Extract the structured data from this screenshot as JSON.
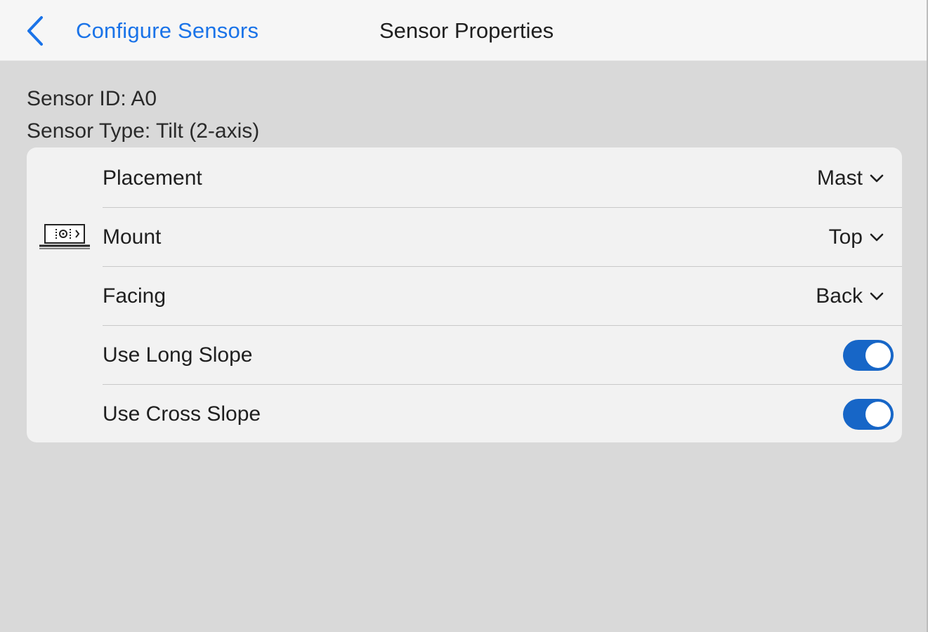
{
  "header": {
    "back_label": "Configure Sensors",
    "title": "Sensor Properties"
  },
  "sensor": {
    "id_text": "Sensor ID: A0",
    "type_text": "Sensor Type: Tilt (2-axis)",
    "icon": "tilt-sensor-icon"
  },
  "properties": {
    "placement": {
      "label": "Placement",
      "value": "Mast"
    },
    "mount": {
      "label": "Mount",
      "value": "Top"
    },
    "facing": {
      "label": "Facing",
      "value": "Back"
    },
    "use_long_slope": {
      "label": "Use Long Slope",
      "checked": true
    },
    "use_cross_slope": {
      "label": "Use Cross Slope",
      "checked": true
    }
  },
  "colors": {
    "accent": "#1a73e8",
    "toggle_on": "#1766c7",
    "background": "#d9d9d9",
    "card": "#f2f2f2",
    "header": "#f6f6f6"
  }
}
